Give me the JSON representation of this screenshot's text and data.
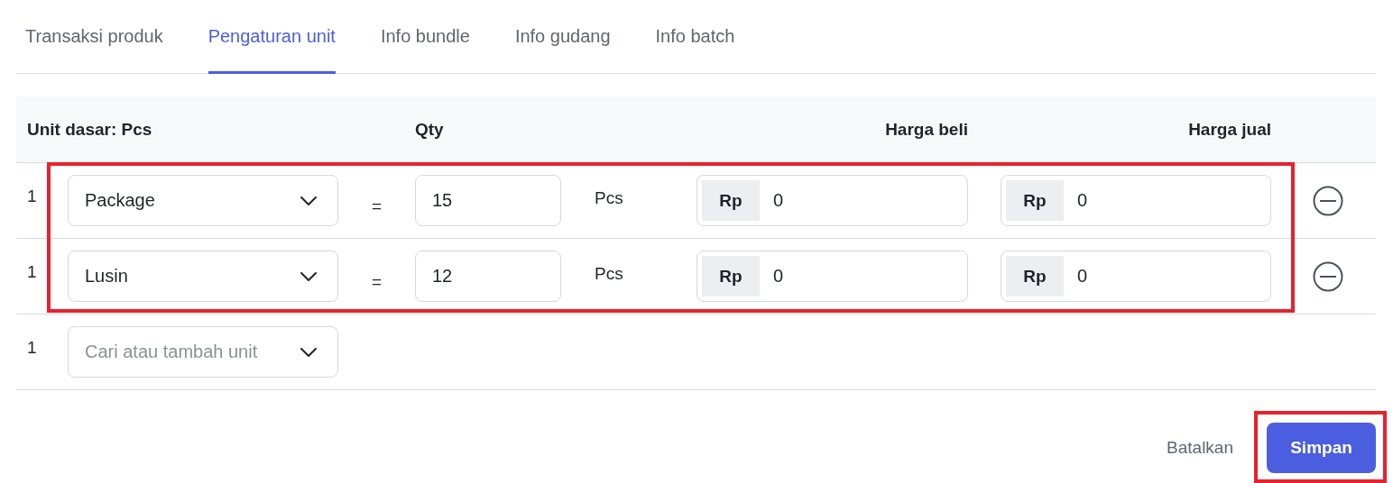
{
  "tabs": [
    {
      "label": "Transaksi produk",
      "selected": false
    },
    {
      "label": "Pengaturan unit",
      "selected": true
    },
    {
      "label": "Info bundle",
      "selected": false
    },
    {
      "label": "Info gudang",
      "selected": false
    },
    {
      "label": "Info batch",
      "selected": false
    }
  ],
  "table": {
    "columns": [
      "Unit dasar: Pcs",
      "Qty",
      "Harga beli",
      "Harga jual"
    ],
    "rows": [
      {
        "index": "1",
        "unit": "Package",
        "equals": "=",
        "qty": "15",
        "base_unit": "Pcs",
        "buy": {
          "prefix": "Rp",
          "value": "0"
        },
        "sell": {
          "prefix": "Rp",
          "value": "0"
        },
        "highlighted": true
      },
      {
        "index": "1",
        "unit": "Lusin",
        "equals": "=",
        "qty": "12",
        "base_unit": "Pcs",
        "buy": {
          "prefix": "Rp",
          "value": "0"
        },
        "sell": {
          "prefix": "Rp",
          "value": "0"
        },
        "highlighted": true
      }
    ],
    "new_row": {
      "index": "1",
      "placeholder": "Cari atau tambah unit"
    }
  },
  "actions": [
    {
      "label": "Batalkan",
      "kind": "link",
      "highlighted": false
    },
    {
      "label": "Simpan",
      "kind": "primary",
      "highlighted": true
    }
  ]
}
